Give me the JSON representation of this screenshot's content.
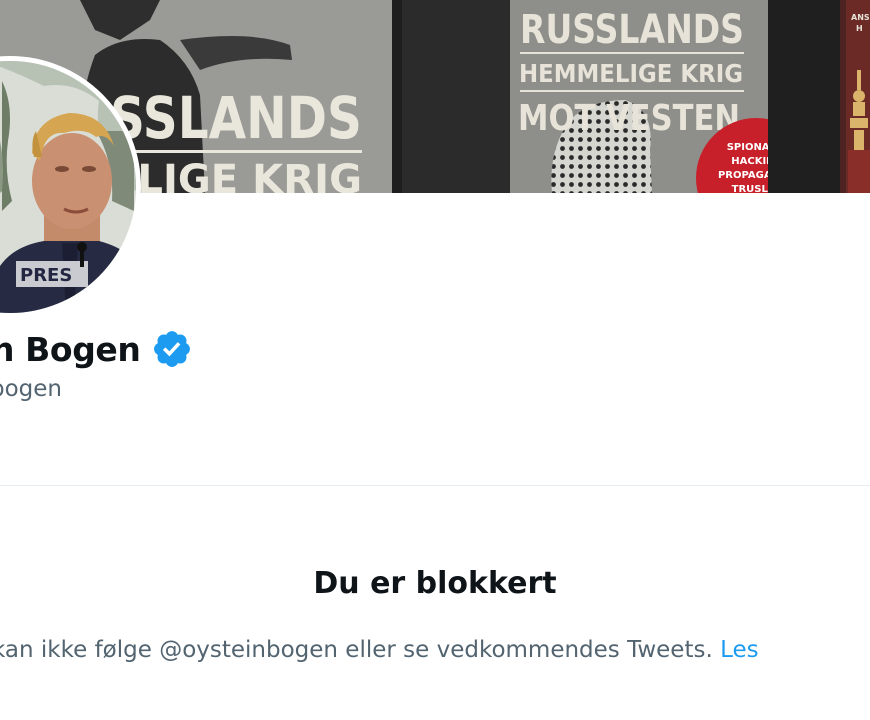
{
  "banner": {
    "book_left": {
      "title_line1": "SSLANDS",
      "title_line2": "ELIGE KRIG"
    },
    "book_center": {
      "title_line1": "RUSSLANDS",
      "title_line2": "HEMMELIGE KRIG",
      "title_line3": "MOT VESTEN",
      "badge_line1": "SPIONASJE",
      "badge_line2": "HACKING",
      "badge_line3": "PROPAGANDA",
      "badge_line4": "TRUSLER"
    },
    "book_right": {
      "text_top": "ANS",
      "text_bottom": "H"
    }
  },
  "profile": {
    "vest_text": "PRES",
    "display_name": "n Bogen",
    "handle": "bogen",
    "verified": true,
    "verified_color": "#1d9bf0"
  },
  "blocked": {
    "title": "Du er blokkert",
    "description": "kan ikke følge @oysteinbogen eller se vedkommendes Tweets.",
    "link_label": "Les"
  },
  "colors": {
    "text_primary": "#0f1419",
    "text_secondary": "#536471",
    "accent": "#1d9bf0",
    "divider": "#e6ecf0"
  }
}
